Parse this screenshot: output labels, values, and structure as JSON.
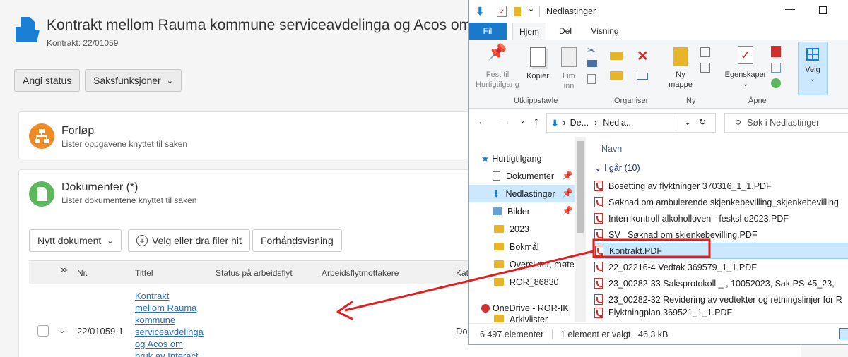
{
  "case": {
    "title": "Kontrakt mellom Rauma kommune serviceavdelinga og Acos om",
    "subtitle": "Kontrakt: 22/01059"
  },
  "toolbar": {
    "status_label": "Angi status",
    "functions_label": "Saksfunksjoner"
  },
  "forlop": {
    "title": "Forløp",
    "subtitle": "Lister oppgavene knyttet til saken"
  },
  "dokumenter": {
    "title": "Dokumenter (*)",
    "subtitle": "Lister dokumentene knyttet til saken",
    "new_doc": "Nytt dokument",
    "choose_files": "Velg eller dra filer hit",
    "preview": "Forhåndsvisning",
    "columns": [
      "Nr.",
      "Tittel",
      "Status på arbeidsflyt",
      "Arbeidsflytmottakere",
      "Kat"
    ],
    "row": {
      "nr": "22/01059-1",
      "title_lines": [
        "Kontrakt",
        "mellom Rauma",
        "kommune",
        "serviceavdelinga",
        "og Acos om",
        "bruk av Interact"
      ],
      "cat": "Do"
    }
  },
  "explorer": {
    "window_title": "Nedlastinger",
    "tabs": {
      "file": "Fil",
      "home": "Hjem",
      "share": "Del",
      "view": "Visning"
    },
    "ribbon": {
      "pin": [
        "Fest til",
        "Hurtigtilgang"
      ],
      "copy": "Kopier",
      "paste": [
        "Lim",
        "inn"
      ],
      "new_folder": [
        "Ny",
        "mappe"
      ],
      "properties": "Egenskaper",
      "select": "Velg",
      "groups": {
        "clipboard": "Utklippstavle",
        "organize": "Organiser",
        "new": "Ny",
        "open": "Åpne"
      }
    },
    "breadcrumb": {
      "part1": "De...",
      "part2": "Nedla..."
    },
    "search_placeholder": "Søk i Nedlastinger",
    "nav": {
      "quick": "Hurtigtilgang",
      "items": [
        "Dokumenter",
        "Nedlastinger",
        "Bilder",
        "2023",
        "Bokmål",
        "Oversikter, møte",
        "ROR_86830"
      ],
      "onedrive": "OneDrive - ROR-IK",
      "last": "Arkivlister"
    },
    "column_name": "Navn",
    "group_label": "I går (10)",
    "files": [
      "Bosetting av flyktninger 370316_1_1.PDF",
      "Søknad om ambulerende skjenkebevilling_skjenkebevilling",
      "Internkontroll alkoholloven - fesksl o2023.PDF",
      "SV_ Søknad om skjenkebevilling.PDF",
      "Kontrakt.PDF",
      "22_02216-4 Vedtak 369579_1_1.PDF",
      "23_00282-33 Saksprotokoll _    , 10052023, Sak PS-45_23,",
      "23_00282-32 Revidering av vedtekter og retningslinjer for R",
      "Flyktningplan 369521_1_1.PDF"
    ],
    "status_count": "6 497 elementer",
    "status_selected": "1 element er valgt",
    "status_size": "46,3 kB"
  },
  "colors": {
    "accent_orange": "#f08a24",
    "accent_green": "#5cb85c",
    "link": "#2a6fb8",
    "annotation_red": "#e02020",
    "case_icon": "#1b7fd4"
  }
}
